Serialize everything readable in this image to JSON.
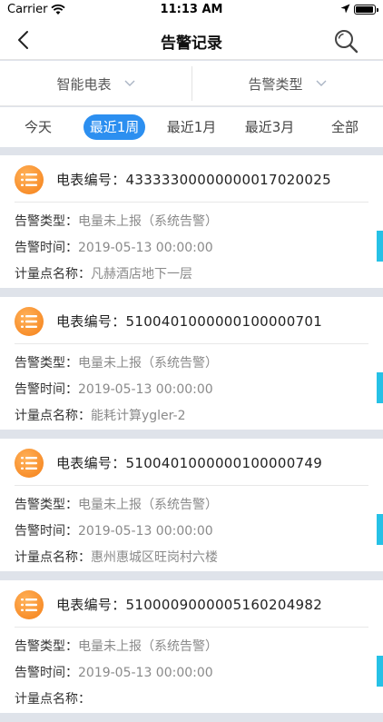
{
  "status_bar": {
    "carrier": "Carrier",
    "time": "11:13 AM"
  },
  "nav": {
    "title": "告警记录"
  },
  "filters": [
    {
      "label": "智能电表"
    },
    {
      "label": "告警类型"
    }
  ],
  "tabs": [
    {
      "label": "今天"
    },
    {
      "label": "最近1周",
      "active": true
    },
    {
      "label": "最近1月"
    },
    {
      "label": "最近3月"
    },
    {
      "label": "全部"
    }
  ],
  "records": [
    {
      "meter_label": "电表编号：",
      "meter_no": "43333300000000017020025",
      "type_label": "告警类型：",
      "type": "电量未上报（系统告警）",
      "time_label": "告警时间：",
      "time": "2019-05-13 00:00:00",
      "point_label": "计量点名称：",
      "point": "凡赫酒店地下一层"
    },
    {
      "meter_label": "电表编号：",
      "meter_no": "5100401000000100000701",
      "type_label": "告警类型：",
      "type": "电量未上报（系统告警）",
      "time_label": "告警时间：",
      "time": "2019-05-13 00:00:00",
      "point_label": "计量点名称：",
      "point": "能耗计算ygler-2"
    },
    {
      "meter_label": "电表编号：",
      "meter_no": "5100401000000100000749",
      "type_label": "告警类型：",
      "type": "电量未上报（系统告警）",
      "time_label": "告警时间：",
      "time": "2019-05-13 00:00:00",
      "point_label": "计量点名称：",
      "point": "惠州惠城区旺岗村六楼"
    },
    {
      "meter_label": "电表编号：",
      "meter_no": "5100009000005160204982",
      "type_label": "告警类型：",
      "type": "电量未上报（系统告警）",
      "time_label": "告警时间：",
      "time": "2019-05-13 00:00:00",
      "point_label": "计量点名称：",
      "point": ""
    }
  ],
  "colors": {
    "accent": "#2c8ff0",
    "badge": "#f57f17",
    "side_marker": "#26c1e6"
  },
  "icons": {
    "back": "chevron-left-icon",
    "search": "search-icon",
    "wifi": "wifi-icon",
    "location": "location-arrow-icon",
    "battery": "battery-icon",
    "badge": "list-icon",
    "dropdown": "chevron-down-icon"
  }
}
